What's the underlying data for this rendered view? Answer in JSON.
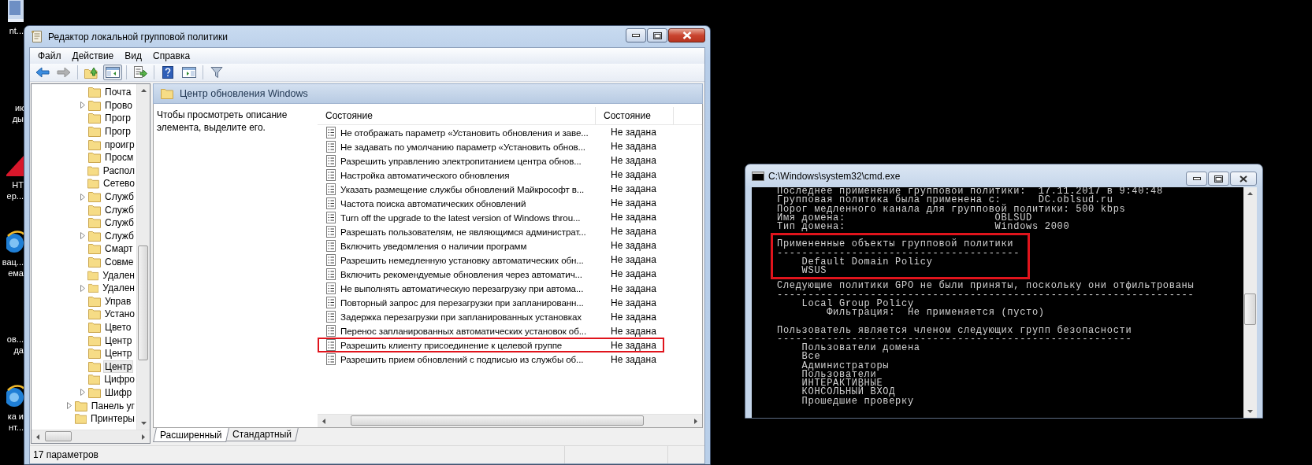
{
  "desktop_icons": [
    {
      "kind": "app",
      "lines": [
        "nt..."
      ]
    },
    {
      "kind": "covered",
      "lines": [
        "ик",
        "ды"
      ]
    },
    {
      "kind": "red",
      "lines": [
        "НТ",
        "ер..."
      ]
    },
    {
      "kind": "globe",
      "lines": [
        "вац...",
        "ема"
      ]
    },
    {
      "kind": "covered",
      "lines": [
        "ов...",
        "да"
      ]
    },
    {
      "kind": "globe",
      "lines": [
        "ка и",
        "нт..."
      ]
    }
  ],
  "editor_window": {
    "title": "Редактор локальной групповой политики",
    "menu": [
      "Файл",
      "Действие",
      "Вид",
      "Справка"
    ],
    "toolbar": [
      {
        "kind": "back",
        "disabled": false,
        "pressed": false
      },
      {
        "kind": "forward",
        "disabled": true,
        "pressed": false
      },
      {
        "kind": "separator"
      },
      {
        "kind": "up",
        "disabled": false,
        "pressed": false
      },
      {
        "kind": "tree",
        "disabled": false,
        "pressed": true
      },
      {
        "kind": "separator"
      },
      {
        "kind": "export",
        "disabled": false,
        "pressed": false
      },
      {
        "kind": "separator"
      },
      {
        "kind": "help",
        "disabled": false,
        "pressed": false
      },
      {
        "kind": "panel",
        "disabled": false,
        "pressed": false
      },
      {
        "kind": "separator"
      },
      {
        "kind": "filter",
        "disabled": false,
        "pressed": false
      }
    ],
    "tree": {
      "items": [
        {
          "children": [
            {
              "label": "Почта",
              "expandable": false,
              "selected": false
            },
            {
              "label": "Прово",
              "expandable": true,
              "selected": false
            },
            {
              "label": "Прогр",
              "expandable": false,
              "selected": false
            },
            {
              "label": "Прогр",
              "expandable": false,
              "selected": false
            },
            {
              "label": "проигр",
              "expandable": false,
              "selected": false
            },
            {
              "label": "Просм",
              "expandable": false,
              "selected": false
            },
            {
              "label": "Распол",
              "expandable": false,
              "selected": false
            },
            {
              "label": "Сетево",
              "expandable": false,
              "selected": false
            },
            {
              "label": "Служб",
              "expandable": true,
              "selected": false
            },
            {
              "label": "Служб",
              "expandable": false,
              "selected": false
            },
            {
              "label": "Служб",
              "expandable": false,
              "selected": false
            },
            {
              "label": "Служб",
              "expandable": true,
              "selected": false
            },
            {
              "label": "Смарт",
              "expandable": false,
              "selected": false
            },
            {
              "label": "Совме",
              "expandable": false,
              "selected": false
            },
            {
              "label": "Удален",
              "expandable": false,
              "selected": false
            },
            {
              "label": "Удален",
              "expandable": true,
              "selected": false
            },
            {
              "label": "Управ",
              "expandable": false,
              "selected": false
            },
            {
              "label": "Устано",
              "expandable": false,
              "selected": false
            },
            {
              "label": "Цвето",
              "expandable": false,
              "selected": false
            },
            {
              "label": "Центр",
              "expandable": false,
              "selected": false
            },
            {
              "label": "Центр",
              "expandable": false,
              "selected": false
            },
            {
              "label": "Центр",
              "expandable": false,
              "selected": true
            },
            {
              "label": "Цифро",
              "expandable": false,
              "selected": false
            },
            {
              "label": "Шифр",
              "expandable": true,
              "selected": false
            }
          ]
        },
        {
          "label": "Панель уг",
          "expandable": true,
          "selected": false
        },
        {
          "label": "Принтеры",
          "expandable": false,
          "selected": false
        }
      ]
    },
    "pane_title": "Центр обновления Windows",
    "description": "Чтобы просмотреть описание элемента, выделите его.",
    "policy_list": {
      "columns": [
        "Состояние",
        "Состояние"
      ],
      "rows": [
        {
          "name": "Не отображать параметр «Установить обновления и заве...",
          "state": "Не задана",
          "highlighted": false
        },
        {
          "name": "Не задавать по умолчанию параметр «Установить обнов...",
          "state": "Не задана",
          "highlighted": false
        },
        {
          "name": "Разрешить управлению электропитанием центра обнов...",
          "state": "Не задана",
          "highlighted": false
        },
        {
          "name": "Настройка автоматического обновления",
          "state": "Не задана",
          "highlighted": false
        },
        {
          "name": "Указать размещение службы обновлений Майкрософт в...",
          "state": "Не задана",
          "highlighted": false
        },
        {
          "name": "Частота поиска автоматических обновлений",
          "state": "Не задана",
          "highlighted": false
        },
        {
          "name": "Turn off the upgrade to the latest version of Windows throu...",
          "state": "Не задана",
          "highlighted": false
        },
        {
          "name": "Разрешать пользователям, не являющимся администрат...",
          "state": "Не задана",
          "highlighted": false
        },
        {
          "name": "Включить уведомления о наличии программ",
          "state": "Не задана",
          "highlighted": false
        },
        {
          "name": "Разрешить немедленную установку автоматических обн...",
          "state": "Не задана",
          "highlighted": false
        },
        {
          "name": "Включить рекомендуемые обновления через автоматич...",
          "state": "Не задана",
          "highlighted": false
        },
        {
          "name": "Не выполнять автоматическую перезагрузку при автома...",
          "state": "Не задана",
          "highlighted": false
        },
        {
          "name": "Повторный запрос для перезагрузки при запланированн...",
          "state": "Не задана",
          "highlighted": false
        },
        {
          "name": "Задержка перезагрузки при запланированных установках",
          "state": "Не задана",
          "highlighted": false
        },
        {
          "name": "Перенос запланированных автоматических установок об...",
          "state": "Не задана",
          "highlighted": false
        },
        {
          "name": "Разрешить клиенту присоединение к целевой группе",
          "state": "Не задана",
          "highlighted": true
        },
        {
          "name": "Разрешить прием обновлений с подписью из службы об...",
          "state": "Не задана",
          "highlighted": false
        }
      ]
    },
    "tabs": [
      {
        "label": "Расширенный",
        "selected": true
      },
      {
        "label": "Стандартный",
        "selected": false
      }
    ],
    "status_bar": "17 параметров"
  },
  "console_window": {
    "title": "C:\\Windows\\system32\\cmd.exe",
    "blocks": [
      {
        "highlighted": false,
        "lines": [
          "Последнее применение групповой политики:  17.11.2017 в 9:40:48",
          "Групповая политика была применена с:      DC.oblsud.ru",
          "Порог медленного канала для групповой политики: 500 kbps",
          "Имя домена:                        OBLSUD",
          "Тип домена:                        Windows 2000"
        ]
      },
      {
        "highlighted": true,
        "lines": [
          "Примененные объекты групповой политики",
          "---------------------------------------",
          "    Default Domain Policy",
          "    WSUS"
        ]
      },
      {
        "highlighted": false,
        "lines": [
          "Следующие политики GPO не были приняты, поскольку они отфильтрованы",
          "-------------------------------------------------------------------",
          "    Local Group Policy",
          "        Фильтрация:  Не применяется (пусто)"
        ]
      },
      {
        "highlighted": false,
        "lines": [
          "Пользователь является членом следующих групп безопасности",
          "---------------------------------------------------------",
          "    Пользователи домена",
          "    Все",
          "    Администраторы",
          "    Пользователи",
          "    ИНТЕРАКТИВНЫЕ",
          "    КОНСОЛЬНЫЙ ВХОД",
          "    Прошедшие проверку"
        ]
      }
    ]
  }
}
